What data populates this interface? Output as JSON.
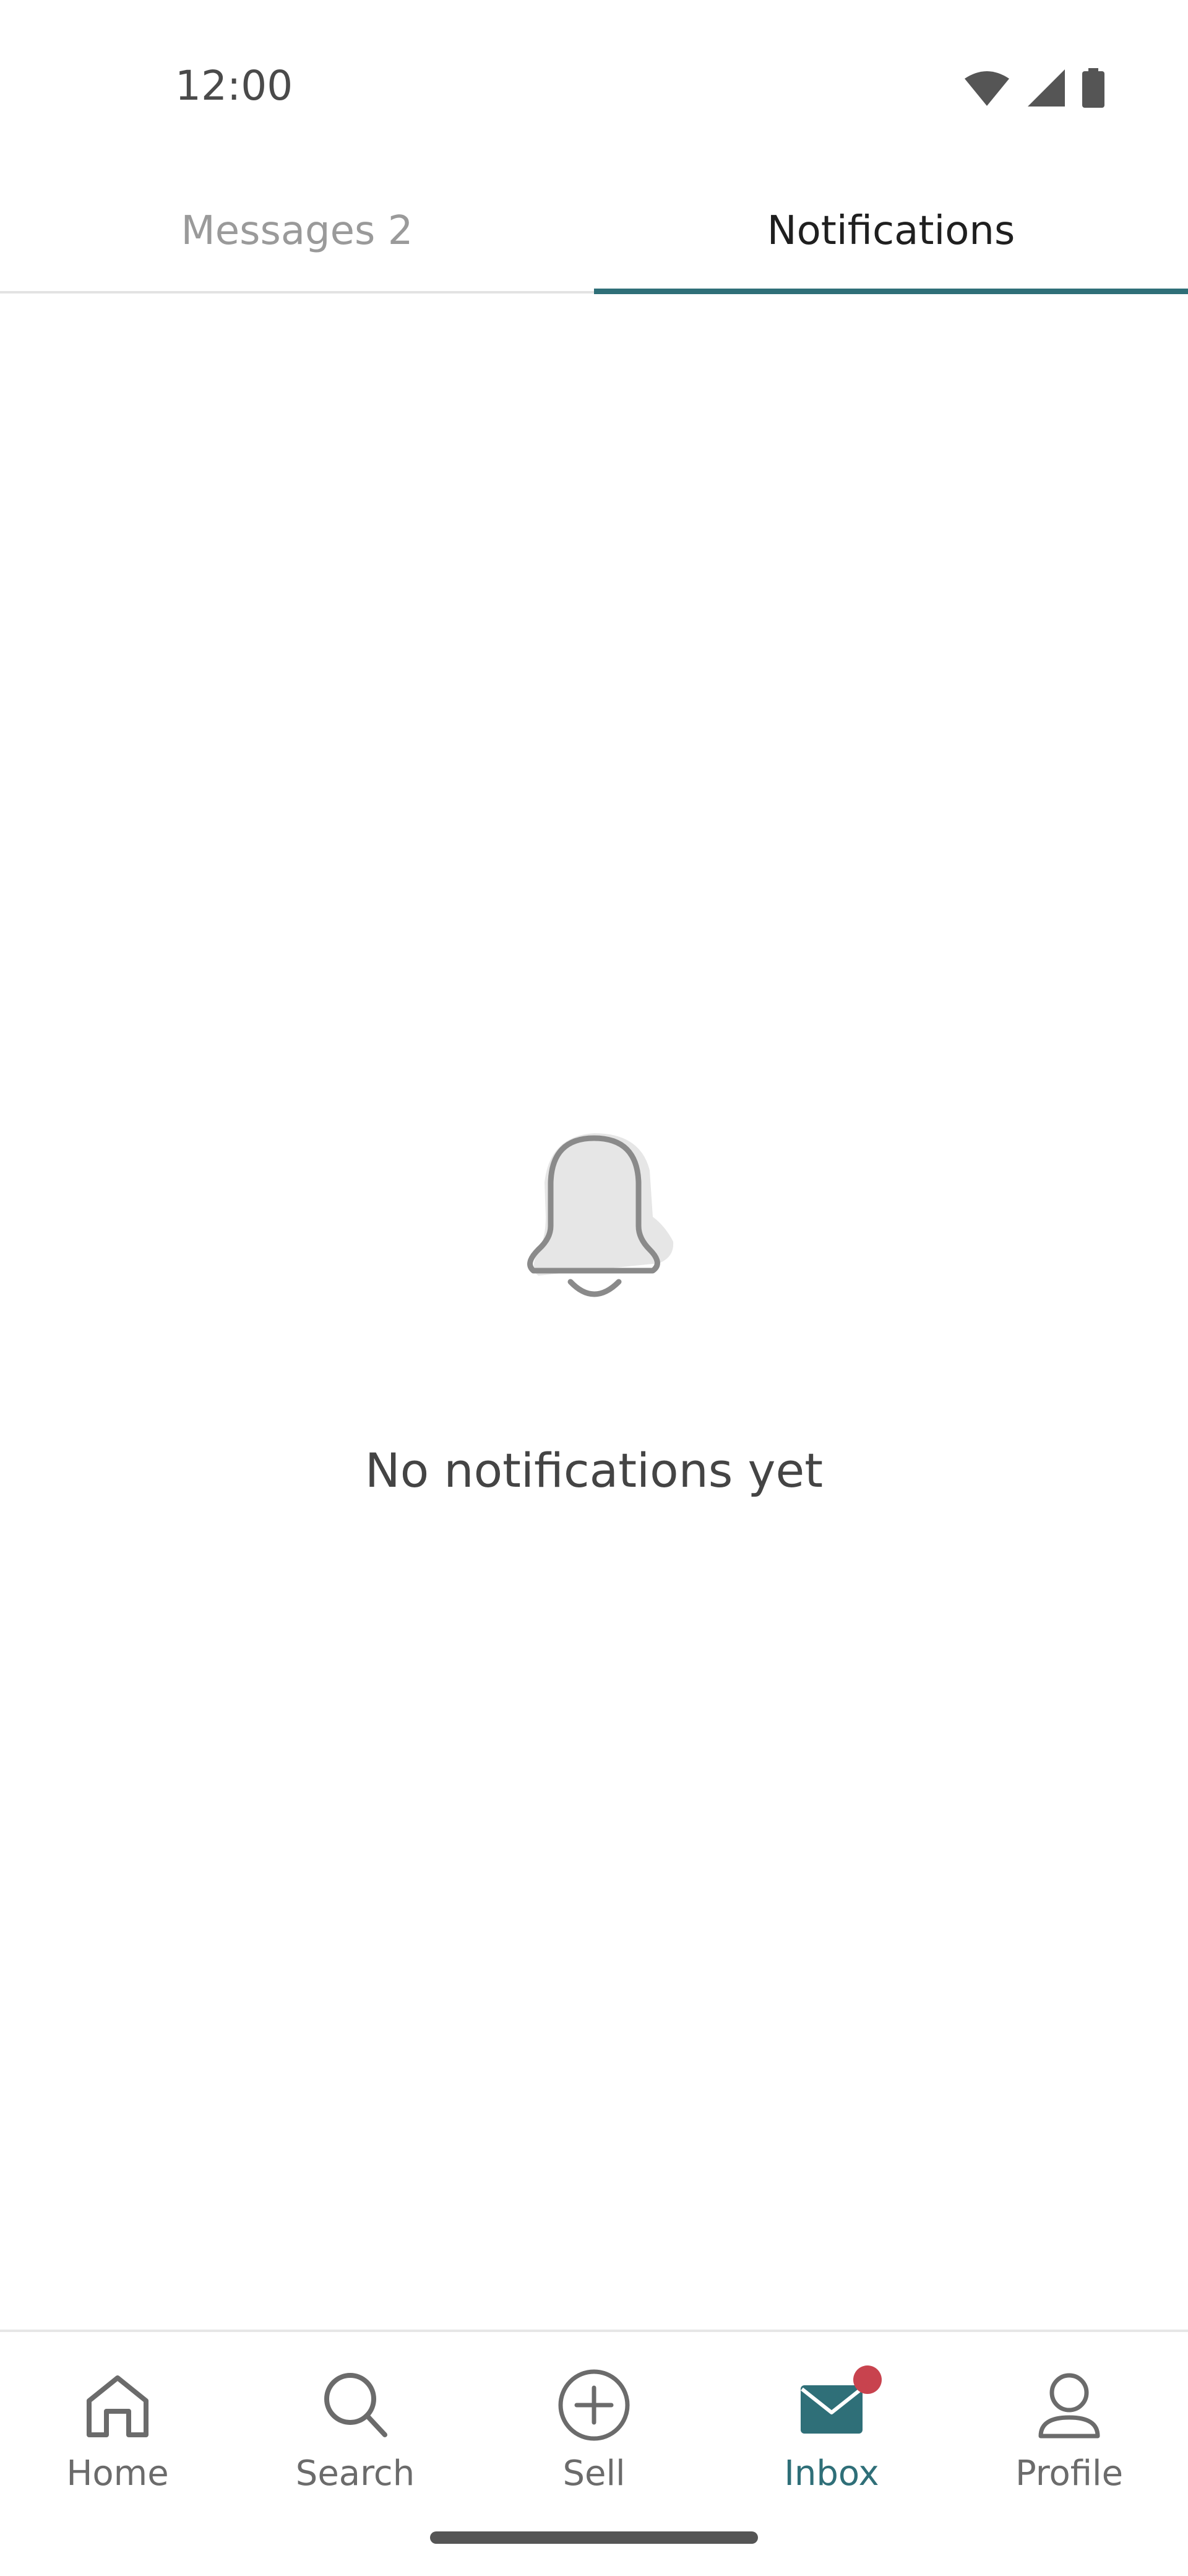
{
  "status_bar": {
    "time": "12:00",
    "icons": [
      "wifi-icon",
      "signal-icon",
      "battery-icon"
    ]
  },
  "tabs": [
    {
      "label": "Messages 2",
      "active": false
    },
    {
      "label": "Notifications",
      "active": true
    }
  ],
  "empty_state": {
    "icon": "bell-icon",
    "message": "No notifications yet"
  },
  "bottom_nav": {
    "items": [
      {
        "label": "Home",
        "icon": "home-icon",
        "active": false
      },
      {
        "label": "Search",
        "icon": "search-icon",
        "active": false
      },
      {
        "label": "Sell",
        "icon": "plus-circle-icon",
        "active": false
      },
      {
        "label": "Inbox",
        "icon": "mail-icon",
        "active": true,
        "badge": true
      },
      {
        "label": "Profile",
        "icon": "person-icon",
        "active": false
      }
    ]
  },
  "colors": {
    "accent": "#2f6f78",
    "badge": "#c8434e",
    "inactive": "#6b6b6b",
    "text": "#444444"
  }
}
